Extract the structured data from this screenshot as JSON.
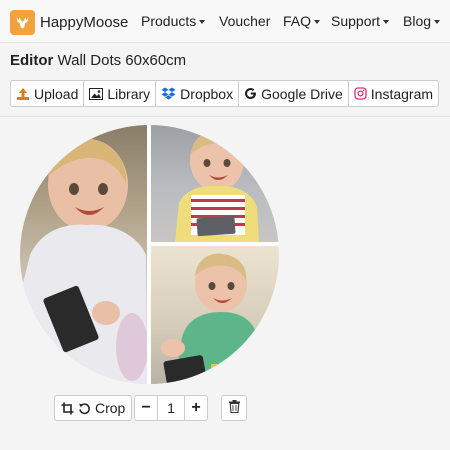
{
  "brand": {
    "name": "HappyMoose",
    "accent": "#f2a23a"
  },
  "nav": {
    "products": "Products",
    "voucher": "Voucher",
    "faq": "FAQ",
    "support": "Support",
    "blog": "Blog"
  },
  "editor": {
    "label": "Editor",
    "product": "Wall Dots 60x60cm"
  },
  "sources": {
    "upload": "Upload",
    "library": "Library",
    "dropbox": "Dropbox",
    "google_drive": "Google Drive",
    "instagram": "Instagram"
  },
  "photo_tools": {
    "crop_label": "Crop",
    "quantity": "1",
    "minus": "−",
    "plus": "+"
  },
  "icons": {
    "upload": "upload-icon",
    "library": "image-icon",
    "dropbox": "dropbox-icon",
    "google_drive": "google-icon",
    "instagram": "instagram-icon",
    "crop": "crop-icon",
    "rotate": "rotate-icon",
    "delete": "trash-icon"
  }
}
